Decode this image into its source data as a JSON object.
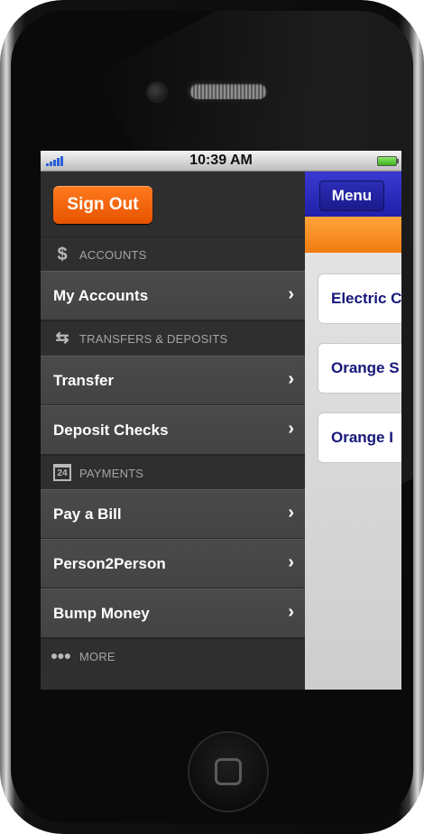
{
  "status_bar": {
    "time": "10:39 AM"
  },
  "menu": {
    "sign_out_label": "Sign Out",
    "sections": [
      {
        "label": "ACCOUNTS",
        "icon": "dollar-icon",
        "items": [
          {
            "label": "My Accounts"
          }
        ]
      },
      {
        "label": "TRANSFERS & DEPOSITS",
        "icon": "transfer-arrows-icon",
        "items": [
          {
            "label": "Transfer"
          },
          {
            "label": "Deposit Checks"
          }
        ]
      },
      {
        "label": "PAYMENTS",
        "icon": "calendar-icon",
        "items": [
          {
            "label": "Pay a Bill"
          },
          {
            "label": "Person2Person"
          },
          {
            "label": "Bump Money"
          }
        ]
      },
      {
        "label": "MORE",
        "icon": "ellipsis-icon",
        "items": []
      }
    ],
    "calendar_day": "24"
  },
  "content": {
    "menu_button_label": "Menu",
    "cards": [
      {
        "label": "Electric C"
      },
      {
        "label": "Orange S"
      },
      {
        "label": "Orange I"
      }
    ]
  },
  "colors": {
    "accent": "#f06a0a",
    "nav": "#2a2ac0",
    "card_text": "#16167a"
  }
}
